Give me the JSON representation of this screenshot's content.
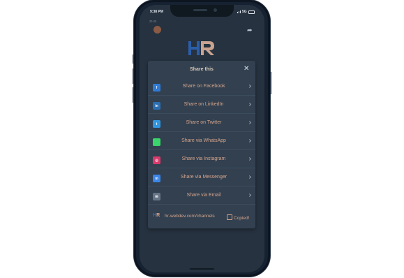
{
  "status_bar": {
    "time": "9:38 PM",
    "signal": "5G"
  },
  "app": {
    "label": "ZH.B"
  },
  "share": {
    "title": "Share this",
    "close_symbol": "✕",
    "items": [
      {
        "label": "Share on Facebook",
        "icon": "facebook-icon",
        "icon_text": "f"
      },
      {
        "label": "Share on LinkedIn",
        "icon": "linkedin-icon",
        "icon_text": "in"
      },
      {
        "label": "Share on Twitter",
        "icon": "twitter-icon",
        "icon_text": "t"
      },
      {
        "label": "Share via WhatsApp",
        "icon": "whatsapp-icon",
        "icon_text": ""
      },
      {
        "label": "Share via Instagram",
        "icon": "instagram-icon",
        "icon_text": "◎"
      },
      {
        "label": "Share via Messenger",
        "icon": "messenger-icon",
        "icon_text": "m"
      },
      {
        "label": "Share via Email",
        "icon": "email-icon",
        "icon_text": "✉"
      }
    ],
    "link": {
      "text": "hr-webdev.com/channels",
      "copied_label": "Copied!"
    }
  },
  "colors": {
    "sheet_bg": "#324050",
    "label": "#d7a58b",
    "screen_bg": "#26323f"
  }
}
